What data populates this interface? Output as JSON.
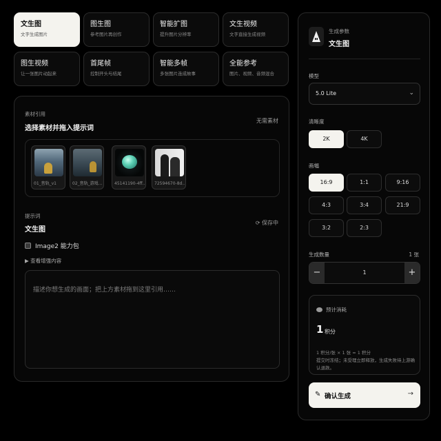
{
  "modes": [
    {
      "title": "文生图",
      "desc": "文字生成图片",
      "active": true
    },
    {
      "title": "图生图",
      "desc": "参考图片再创作"
    },
    {
      "title": "智能扩图",
      "desc": "提升图片分辨率"
    },
    {
      "title": "文生视频",
      "desc": "文字直接生成视频"
    },
    {
      "title": "图生视频",
      "desc": "让一张图片动起来"
    },
    {
      "title": "首尾帧",
      "desc": "控制开头与结尾"
    },
    {
      "title": "智能多帧",
      "desc": "多张图片连成故事"
    },
    {
      "title": "全能参考",
      "desc": "图片、视频、音频混合"
    }
  ],
  "materials": {
    "label": "素材引用",
    "title": "选择素材并拖入提示词",
    "none_label": "无需素材",
    "items": [
      {
        "caption": "01_音轨_v1"
      },
      {
        "caption": "02_音轨_游戏..."
      },
      {
        "caption": "45141190-4ff..."
      },
      {
        "caption": "72594670-8d..."
      }
    ]
  },
  "prompt": {
    "label": "提示词",
    "title": "文生图",
    "saving": "保存中",
    "checkbox_label": "Image2 能力包",
    "expand_label": "查看增强内容",
    "placeholder": "描述你想生成的画面；把上方素材拖到这里引用……"
  },
  "panel": {
    "subtitle": "生成参数",
    "title": "文生图",
    "model_label": "模型",
    "model_value": "5.0 Lite",
    "clarity_label": "清晰度",
    "clarity_options": [
      "2K",
      "4K"
    ],
    "clarity_selected": "2K",
    "ratio_label": "画幅",
    "ratio_options": [
      "16:9",
      "1:1",
      "9:16",
      "4:3",
      "3:4",
      "21:9",
      "3:2",
      "2:3"
    ],
    "ratio_selected": "16:9",
    "quantity_label": "生成数量",
    "quantity_unit": "1 张",
    "quantity_value": "1",
    "minus": "−",
    "plus": "+"
  },
  "cost": {
    "title": "预计消耗",
    "amount": "1",
    "unit": "积分",
    "formula": "1 积分/张 × 1 张 = 1 积分",
    "note": "提交时冻结；未受理立即释放，生成失败待上游确认退款。"
  },
  "confirm": {
    "label": "确认生成",
    "arrow": "→"
  }
}
